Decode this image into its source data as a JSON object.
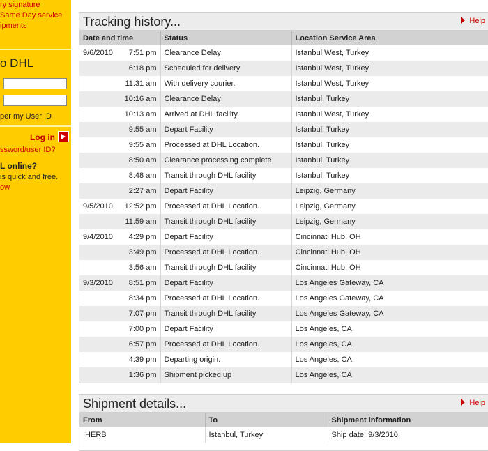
{
  "sidebar": {
    "link1": "ry signature",
    "link2": "Same Day service",
    "link3": "ipments",
    "login_heading": "o DHL",
    "remember_text": "per my User ID",
    "login_label": "Log in",
    "forgot_text": "ssword/user ID?",
    "promo_title": "L online?",
    "promo_text": "is quick and free.",
    "promo_link": "ow"
  },
  "tracking": {
    "title": "Tracking history...",
    "help": "Help",
    "headers": [
      "Date and time",
      "Status",
      "Location Service Area"
    ],
    "rows": [
      {
        "date": "9/6/2010",
        "time": "7:51 pm",
        "status": "Clearance Delay",
        "location": "Istanbul West, Turkey"
      },
      {
        "date": "",
        "time": "6:18 pm",
        "status": "Scheduled for delivery",
        "location": "Istanbul West, Turkey"
      },
      {
        "date": "",
        "time": "11:31 am",
        "status": "With delivery courier.",
        "location": "Istanbul West, Turkey"
      },
      {
        "date": "",
        "time": "10:16 am",
        "status": "Clearance Delay",
        "location": "Istanbul, Turkey"
      },
      {
        "date": "",
        "time": "10:13 am",
        "status": "Arrived at DHL facility.",
        "location": "Istanbul West, Turkey"
      },
      {
        "date": "",
        "time": "9:55 am",
        "status": "Depart Facility",
        "location": "Istanbul, Turkey"
      },
      {
        "date": "",
        "time": "9:55 am",
        "status": "Processed at DHL Location.",
        "location": "Istanbul, Turkey"
      },
      {
        "date": "",
        "time": "8:50 am",
        "status": "Clearance processing complete",
        "location": "Istanbul, Turkey"
      },
      {
        "date": "",
        "time": "8:48 am",
        "status": "Transit through DHL facility",
        "location": "Istanbul, Turkey"
      },
      {
        "date": "",
        "time": "2:27 am",
        "status": "Depart Facility",
        "location": "Leipzig, Germany"
      },
      {
        "date": "9/5/2010",
        "time": "12:52 pm",
        "status": "Processed at DHL Location.",
        "location": "Leipzig, Germany"
      },
      {
        "date": "",
        "time": "11:59 am",
        "status": "Transit through DHL facility",
        "location": "Leipzig, Germany"
      },
      {
        "date": "9/4/2010",
        "time": "4:29 pm",
        "status": "Depart Facility",
        "location": "Cincinnati Hub, OH"
      },
      {
        "date": "",
        "time": "3:49 pm",
        "status": "Processed at DHL Location.",
        "location": "Cincinnati Hub, OH"
      },
      {
        "date": "",
        "time": "3:56 am",
        "status": "Transit through DHL facility",
        "location": "Cincinnati Hub, OH"
      },
      {
        "date": "9/3/2010",
        "time": "8:51 pm",
        "status": "Depart Facility",
        "location": "Los Angeles Gateway, CA"
      },
      {
        "date": "",
        "time": "8:34 pm",
        "status": "Processed at DHL Location.",
        "location": "Los Angeles Gateway, CA"
      },
      {
        "date": "",
        "time": "7:07 pm",
        "status": "Transit through DHL facility",
        "location": "Los Angeles Gateway, CA"
      },
      {
        "date": "",
        "time": "7:00 pm",
        "status": "Depart Facility",
        "location": "Los Angeles, CA"
      },
      {
        "date": "",
        "time": "6:57 pm",
        "status": "Processed at DHL Location.",
        "location": "Los Angeles, CA"
      },
      {
        "date": "",
        "time": "4:39 pm",
        "status": "Departing origin.",
        "location": "Los Angeles, CA"
      },
      {
        "date": "",
        "time": "1:36 pm",
        "status": "Shipment picked up",
        "location": "Los Angeles, CA"
      }
    ]
  },
  "shipment": {
    "title": "Shipment details...",
    "help": "Help",
    "headers": [
      "From",
      "To",
      "Shipment information"
    ],
    "from": "IHERB",
    "to": "Istanbul, Turkey",
    "info": "Ship date: 9/3/2010"
  }
}
